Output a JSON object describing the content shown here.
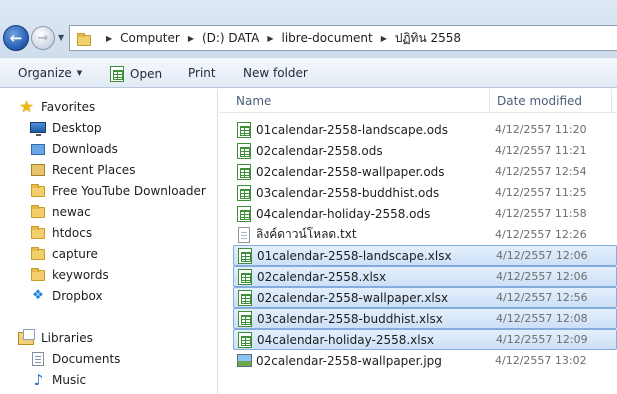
{
  "address_bar": {
    "breadcrumbs": [
      "Computer",
      "(D:) DATA",
      "libre-document",
      "ปฏิทิน 2558"
    ]
  },
  "toolbar": {
    "organize_label": "Organize",
    "open_label": "Open",
    "print_label": "Print",
    "new_folder_label": "New folder"
  },
  "navigation": {
    "favorites_label": "Favorites",
    "favorites": [
      {
        "label": "Desktop",
        "icon": "desktop-icon"
      },
      {
        "label": "Downloads",
        "icon": "downloads-folder-icon"
      },
      {
        "label": "Recent Places",
        "icon": "recent-places-icon"
      },
      {
        "label": "Free YouTube Downloader",
        "icon": "folder-icon"
      },
      {
        "label": "newac",
        "icon": "folder-icon"
      },
      {
        "label": "htdocs",
        "icon": "folder-icon"
      },
      {
        "label": "capture",
        "icon": "folder-icon"
      },
      {
        "label": "keywords",
        "icon": "folder-icon"
      },
      {
        "label": "Dropbox",
        "icon": "dropbox-icon"
      }
    ],
    "libraries_label": "Libraries",
    "libraries": [
      {
        "label": "Documents",
        "icon": "documents-icon"
      },
      {
        "label": "Music",
        "icon": "music-icon"
      }
    ]
  },
  "file_list": {
    "columns": {
      "name": "Name",
      "date_modified": "Date modified"
    },
    "files": [
      {
        "name": "01calendar-2558-landscape.ods",
        "date": "4/12/2557 11:20",
        "type": "spreadsheet",
        "selected": false
      },
      {
        "name": "02calendar-2558.ods",
        "date": "4/12/2557 11:21",
        "type": "spreadsheet",
        "selected": false
      },
      {
        "name": "02calendar-2558-wallpaper.ods",
        "date": "4/12/2557 12:54",
        "type": "spreadsheet",
        "selected": false
      },
      {
        "name": "03calendar-2558-buddhist.ods",
        "date": "4/12/2557 11:25",
        "type": "spreadsheet",
        "selected": false
      },
      {
        "name": "04calendar-holiday-2558.ods",
        "date": "4/12/2557 11:58",
        "type": "spreadsheet",
        "selected": false
      },
      {
        "name": "ลิงค์ดาวน์โหลด.txt",
        "date": "4/12/2557 12:26",
        "type": "text",
        "selected": false
      },
      {
        "name": "01calendar-2558-landscape.xlsx",
        "date": "4/12/2557 12:06",
        "type": "spreadsheet",
        "selected": true
      },
      {
        "name": "02calendar-2558.xlsx",
        "date": "4/12/2557 12:06",
        "type": "spreadsheet",
        "selected": true
      },
      {
        "name": "02calendar-2558-wallpaper.xlsx",
        "date": "4/12/2557 12:56",
        "type": "spreadsheet",
        "selected": true
      },
      {
        "name": "03calendar-2558-buddhist.xlsx",
        "date": "4/12/2557 12:08",
        "type": "spreadsheet",
        "selected": true
      },
      {
        "name": "04calendar-holiday-2558.xlsx",
        "date": "4/12/2557 12:09",
        "type": "spreadsheet",
        "selected": true
      },
      {
        "name": "02calendar-2558-wallpaper.jpg",
        "date": "4/12/2557 13:02",
        "type": "image",
        "selected": false
      }
    ]
  }
}
